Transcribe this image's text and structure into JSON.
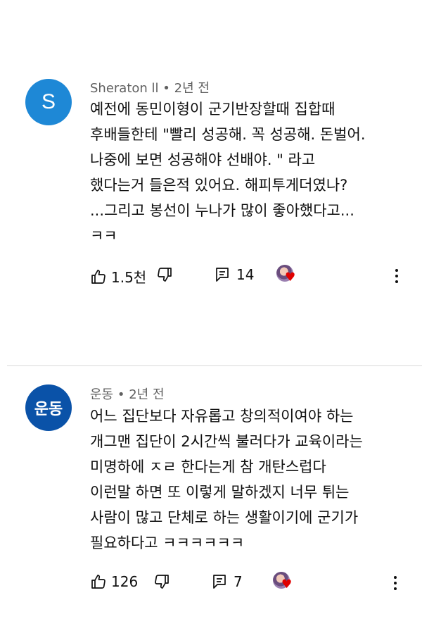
{
  "comments": [
    {
      "avatar_letter": "S",
      "author": "Sheraton ll",
      "separator": "•",
      "time": "2년 전",
      "text": "예전에 동민이형이 군기반장할때 집합때\n후배들한테 \"빨리 성공해. 꼭 성공해. 돈벌어.\n나중에 보면 성공해야 선배야. \" 라고\n했다는거 들은적 있어요. 해피투게더였나?\n...그리고 봉선이 누나가 많이 좋아했다고...\nㅋㅋ",
      "likes": "1.5천",
      "replies": "14"
    },
    {
      "avatar_letter": "운동",
      "author": "운동",
      "separator": "•",
      "time": "2년 전",
      "text": "어느 집단보다 자유롭고 창의적이여야 하는\n개그맨 집단이 2시간씩 불러다가 교육이라는\n미명하에 ㅈㄹ 한다는게 참 개탄스럽다\n이런말 하면 또 이렇게 말하겠지 너무 튀는\n사람이 많고 단체로 하는 생활이기에 군기가\n필요하다고 ㅋㅋㅋㅋㅋㅋ",
      "likes": "126",
      "replies": "7"
    }
  ],
  "colors": {
    "avatar_s": "#1e88d6",
    "avatar_k": "#0a52a8",
    "meta": "#606060",
    "heart": "#e00000"
  },
  "icons": [
    "thumbs-up-icon",
    "thumbs-down-icon",
    "reply-icon",
    "creator-heart-icon",
    "more-vert-icon"
  ]
}
